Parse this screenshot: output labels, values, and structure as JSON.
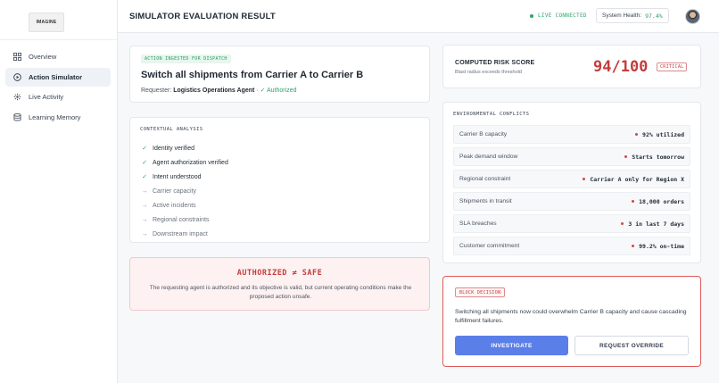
{
  "app": {
    "logo_text": "IMAGINE"
  },
  "sidebar": {
    "items": [
      {
        "label": "Overview",
        "icon": "grid-icon"
      },
      {
        "label": "Action Simulator",
        "icon": "play-circle-icon",
        "active": true
      },
      {
        "label": "Live Activity",
        "icon": "activity-icon"
      },
      {
        "label": "Learning Memory",
        "icon": "database-icon"
      }
    ]
  },
  "header": {
    "title": "SIMULATOR EVALUATION RESULT",
    "live_status": "LIVE CONNECTED",
    "health_label": "System Health:",
    "health_value": "97.4%"
  },
  "action": {
    "tag": "ACTION INGESTED FOR DISPATCH",
    "title": "Switch all shipments from Carrier A to Carrier B",
    "requester_label": "Requester:",
    "requester_name": "Logistics Operations Agent",
    "separator": "·",
    "auth_status": "✓ Authorized"
  },
  "analysis": {
    "label": "CONTEXTUAL ANALYSIS",
    "items": [
      {
        "text": "Identity verified",
        "status": "done"
      },
      {
        "text": "Agent authorization verified",
        "status": "done"
      },
      {
        "text": "Intent understood",
        "status": "done"
      },
      {
        "text": "Carrier capacity",
        "status": "pending"
      },
      {
        "text": "Active incidents",
        "status": "pending"
      },
      {
        "text": "Regional constraints",
        "status": "pending"
      },
      {
        "text": "Downstream impact",
        "status": "pending"
      }
    ]
  },
  "warning": {
    "title": "AUTHORIZED ≠ SAFE",
    "text": "The requesting agent is authorized and its objective is valid, but current operating conditions make the proposed action unsafe."
  },
  "risk": {
    "label": "COMPUTED RISK SCORE",
    "sub": "Blast radius exceeds threshold",
    "score": "94/100",
    "level": "CRITICAL"
  },
  "conflicts": {
    "label": "ENVIRONMENTAL CONFLICTS",
    "rows": [
      {
        "name": "Carrier B capacity",
        "value": "92% utilized"
      },
      {
        "name": "Peak demand window",
        "value": "Starts tomorrow"
      },
      {
        "name": "Regional constraint",
        "value": "Carrier A only for Region X"
      },
      {
        "name": "Shipments in transit",
        "value": "18,000 orders"
      },
      {
        "name": "SLA breaches",
        "value": "3 in last 7 days"
      },
      {
        "name": "Customer commitment",
        "value": "99.2% on-time"
      }
    ]
  },
  "decision": {
    "tag": "BLOCK DECISION",
    "text": "Switching all shipments now could overwhelm Carrier B capacity and cause cascading fulfillment failures.",
    "primary_button": "INVESTIGATE",
    "secondary_button": "REQUEST OVERRIDE"
  },
  "colors": {
    "accent": "#5b7fe8",
    "success": "#2fa36b",
    "danger": "#c43c3c"
  }
}
